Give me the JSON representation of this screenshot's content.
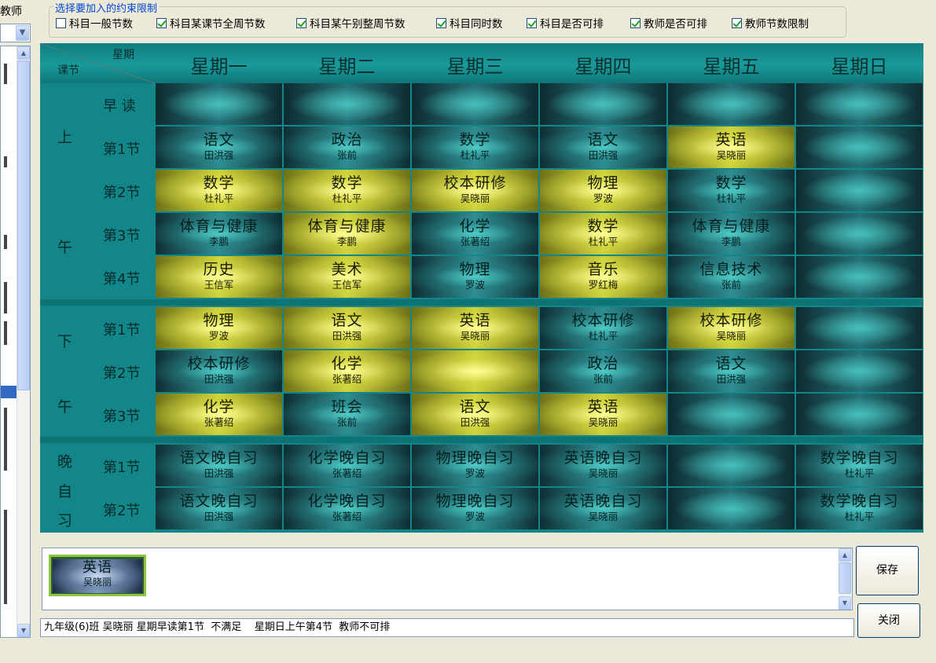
{
  "window": {
    "left_label": "教师"
  },
  "constraints": {
    "title": "选择要加入的约束限制",
    "items": [
      {
        "label": "科目一般节数",
        "checked": false
      },
      {
        "label": "科目某课节全周节数",
        "checked": true
      },
      {
        "label": "科目某午别整周节数",
        "checked": true
      },
      {
        "label": "科目同时数",
        "checked": true
      },
      {
        "label": "科目是否可排",
        "checked": true
      },
      {
        "label": "教师是否可排",
        "checked": true
      },
      {
        "label": "教师节数限制",
        "checked": true
      }
    ]
  },
  "timetable": {
    "corner": {
      "top": "星期",
      "bottom": "课节"
    },
    "days": [
      "星期一",
      "星期二",
      "星期三",
      "星期四",
      "星期五",
      "星期日"
    ],
    "groups": [
      {
        "label": "上午",
        "chars": [
          "上",
          "午"
        ]
      },
      {
        "label": "下午",
        "chars": [
          "下",
          "午"
        ]
      },
      {
        "label": "晚自习",
        "chars": [
          "晚",
          "自",
          "习"
        ]
      }
    ],
    "rows": [
      {
        "label": "早 读",
        "cells": [
          {
            "subject": "",
            "teacher": "",
            "color": "dark"
          },
          {
            "subject": "",
            "teacher": "",
            "color": "dark"
          },
          {
            "subject": "",
            "teacher": "",
            "color": "dark"
          },
          {
            "subject": "",
            "teacher": "",
            "color": "dark"
          },
          {
            "subject": "",
            "teacher": "",
            "color": "dark"
          },
          {
            "subject": "",
            "teacher": "",
            "color": "dark"
          }
        ]
      },
      {
        "label": "第1节",
        "cells": [
          {
            "subject": "语文",
            "teacher": "田洪强",
            "color": "dark"
          },
          {
            "subject": "政治",
            "teacher": "张前",
            "color": "dark"
          },
          {
            "subject": "数学",
            "teacher": "杜礼平",
            "color": "dark"
          },
          {
            "subject": "语文",
            "teacher": "田洪强",
            "color": "dark"
          },
          {
            "subject": "英语",
            "teacher": "吴晓丽",
            "color": "yellow"
          },
          {
            "subject": "",
            "teacher": "",
            "color": "dark"
          }
        ]
      },
      {
        "label": "第2节",
        "cells": [
          {
            "subject": "数学",
            "teacher": "杜礼平",
            "color": "yellow"
          },
          {
            "subject": "数学",
            "teacher": "杜礼平",
            "color": "yellow"
          },
          {
            "subject": "校本研修",
            "teacher": "吴晓丽",
            "color": "yellow"
          },
          {
            "subject": "物理",
            "teacher": "罗波",
            "color": "yellow"
          },
          {
            "subject": "数学",
            "teacher": "杜礼平",
            "color": "dark"
          },
          {
            "subject": "",
            "teacher": "",
            "color": "dark"
          }
        ]
      },
      {
        "label": "第3节",
        "cells": [
          {
            "subject": "体育与健康",
            "teacher": "李鹏",
            "color": "dark"
          },
          {
            "subject": "体育与健康",
            "teacher": "李鹏",
            "color": "yellow"
          },
          {
            "subject": "化学",
            "teacher": "张著绍",
            "color": "dark"
          },
          {
            "subject": "数学",
            "teacher": "杜礼平",
            "color": "yellow"
          },
          {
            "subject": "体育与健康",
            "teacher": "李鹏",
            "color": "dark"
          },
          {
            "subject": "",
            "teacher": "",
            "color": "dark"
          }
        ]
      },
      {
        "label": "第4节",
        "cells": [
          {
            "subject": "历史",
            "teacher": "王信军",
            "color": "yellow"
          },
          {
            "subject": "美术",
            "teacher": "王信军",
            "color": "yellow"
          },
          {
            "subject": "物理",
            "teacher": "罗波",
            "color": "dark"
          },
          {
            "subject": "音乐",
            "teacher": "罗红梅",
            "color": "yellow"
          },
          {
            "subject": "信息技术",
            "teacher": "张前",
            "color": "dark"
          },
          {
            "subject": "",
            "teacher": "",
            "color": "dark"
          }
        ]
      },
      {
        "label": "第1节",
        "cells": [
          {
            "subject": "物理",
            "teacher": "罗波",
            "color": "yellow"
          },
          {
            "subject": "语文",
            "teacher": "田洪强",
            "color": "yellow"
          },
          {
            "subject": "英语",
            "teacher": "吴晓丽",
            "color": "yellow"
          },
          {
            "subject": "校本研修",
            "teacher": "杜礼平",
            "color": "dark"
          },
          {
            "subject": "校本研修",
            "teacher": "吴晓丽",
            "color": "yellow"
          },
          {
            "subject": "",
            "teacher": "",
            "color": "dark"
          }
        ]
      },
      {
        "label": "第2节",
        "cells": [
          {
            "subject": "校本研修",
            "teacher": "田洪强",
            "color": "dark"
          },
          {
            "subject": "化学",
            "teacher": "张著绍",
            "color": "yellow"
          },
          {
            "subject": "",
            "teacher": "",
            "color": "yellow"
          },
          {
            "subject": "政治",
            "teacher": "张前",
            "color": "dark"
          },
          {
            "subject": "语文",
            "teacher": "田洪强",
            "color": "dark"
          },
          {
            "subject": "",
            "teacher": "",
            "color": "dark"
          }
        ]
      },
      {
        "label": "第3节",
        "cells": [
          {
            "subject": "化学",
            "teacher": "张著绍",
            "color": "yellow"
          },
          {
            "subject": "班会",
            "teacher": "张前",
            "color": "dark"
          },
          {
            "subject": "语文",
            "teacher": "田洪强",
            "color": "yellow"
          },
          {
            "subject": "英语",
            "teacher": "吴晓丽",
            "color": "yellow"
          },
          {
            "subject": "",
            "teacher": "",
            "color": "dark"
          },
          {
            "subject": "",
            "teacher": "",
            "color": "dark"
          }
        ]
      },
      {
        "label": "第1节",
        "cells": [
          {
            "subject": "语文晚自习",
            "teacher": "田洪强",
            "color": "dark"
          },
          {
            "subject": "化学晚自习",
            "teacher": "张著绍",
            "color": "dark"
          },
          {
            "subject": "物理晚自习",
            "teacher": "罗波",
            "color": "dark"
          },
          {
            "subject": "英语晚自习",
            "teacher": "吴晓丽",
            "color": "dark"
          },
          {
            "subject": "",
            "teacher": "",
            "color": "dark"
          },
          {
            "subject": "数学晚自习",
            "teacher": "杜礼平",
            "color": "dark"
          }
        ]
      },
      {
        "label": "第2节",
        "cells": [
          {
            "subject": "语文晚自习",
            "teacher": "田洪强",
            "color": "dark"
          },
          {
            "subject": "化学晚自习",
            "teacher": "张著绍",
            "color": "dark"
          },
          {
            "subject": "物理晚自习",
            "teacher": "罗波",
            "color": "dark"
          },
          {
            "subject": "英语晚自习",
            "teacher": "吴晓丽",
            "color": "dark"
          },
          {
            "subject": "",
            "teacher": "",
            "color": "dark"
          },
          {
            "subject": "数学晚自习",
            "teacher": "杜礼平",
            "color": "dark"
          }
        ]
      }
    ]
  },
  "pending": {
    "subject": "英语",
    "teacher": "吴晓丽"
  },
  "status": "九年级(6)班 吴晓丽 星期早读第1节  不满足    星期日上午第4节  教师不可排",
  "buttons": {
    "save": "保存",
    "close": "关闭"
  },
  "colors": {
    "teal": "#128688",
    "cell_dark": "#2f8e92",
    "cell_yellow": "#d0d33b",
    "accent": "#0046d5"
  }
}
